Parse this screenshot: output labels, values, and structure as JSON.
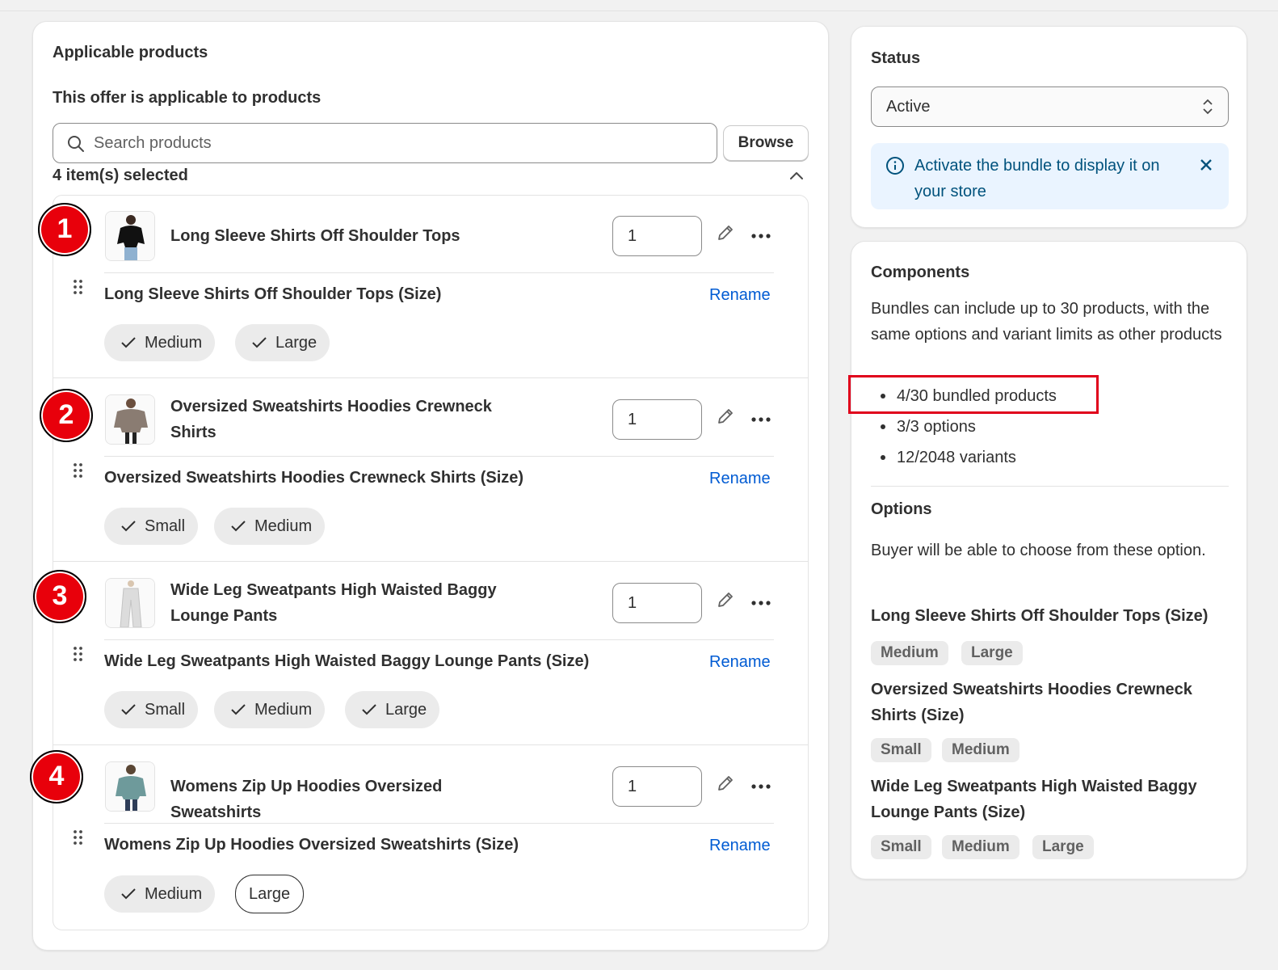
{
  "applicable": {
    "title": "Applicable products",
    "subtitle": "This offer is applicable to products",
    "search_placeholder": "Search products",
    "browse_label": "Browse",
    "selected_count": "4 item(s) selected",
    "products": [
      {
        "badge": "1",
        "name": "Long Sleeve Shirts Off Shoulder Tops",
        "quantity": "1",
        "option_name": "Long Sleeve Shirts Off Shoulder Tops (Size)",
        "rename": "Rename",
        "values": [
          {
            "label": "Medium",
            "checked": true
          },
          {
            "label": "Large",
            "checked": true
          }
        ]
      },
      {
        "badge": "2",
        "name": "Oversized Sweatshirts Hoodies Crewneck Shirts",
        "quantity": "1",
        "option_name": "Oversized Sweatshirts Hoodies Crewneck Shirts (Size)",
        "rename": "Rename",
        "values": [
          {
            "label": "Small",
            "checked": true
          },
          {
            "label": "Medium",
            "checked": true
          }
        ]
      },
      {
        "badge": "3",
        "name": "Wide Leg Sweatpants High Waisted Baggy Lounge Pants",
        "quantity": "1",
        "option_name": "Wide Leg Sweatpants High Waisted Baggy Lounge Pants (Size)",
        "rename": "Rename",
        "values": [
          {
            "label": "Small",
            "checked": true
          },
          {
            "label": "Medium",
            "checked": true
          },
          {
            "label": "Large",
            "checked": true
          }
        ]
      },
      {
        "badge": "4",
        "name": "Womens Zip Up Hoodies Oversized Sweatshirts",
        "quantity": "1",
        "option_name": "Womens Zip Up Hoodies Oversized Sweatshirts (Size)",
        "rename": "Rename",
        "values": [
          {
            "label": "Medium",
            "checked": true
          },
          {
            "label": "Large",
            "checked": false
          }
        ]
      }
    ]
  },
  "status": {
    "title": "Status",
    "selected": "Active",
    "banner": "Activate the bundle to display it on your store"
  },
  "components": {
    "title": "Components",
    "description": "Bundles can include up to 30 products, with the same options and variant limits as other products",
    "limits": [
      "4/30 bundled products",
      "3/3 options",
      "12/2048 variants"
    ]
  },
  "options": {
    "title": "Options",
    "description": "Buyer will be able to choose from these option.",
    "groups": [
      {
        "name": "Long Sleeve Shirts Off Shoulder Tops (Size)",
        "values": [
          "Medium",
          "Large"
        ]
      },
      {
        "name": "Oversized Sweatshirts Hoodies Crewneck Shirts (Size)",
        "values": [
          "Small",
          "Medium"
        ]
      },
      {
        "name": "Wide Leg Sweatpants High Waisted Baggy Lounge Pants (Size)",
        "values": [
          "Small",
          "Medium",
          "Large"
        ]
      }
    ]
  },
  "colors": {
    "link": "#005bd3",
    "badge": "#e8000b",
    "banner_bg": "#eaf4ff",
    "banner_text": "#00527c",
    "highlight": "#e0001b"
  }
}
